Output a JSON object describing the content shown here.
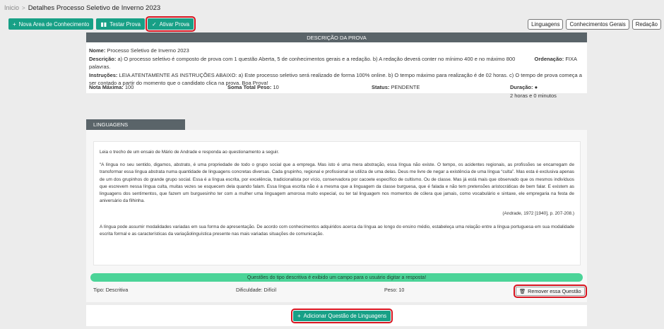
{
  "breadcrumb": {
    "home": "Inicio",
    "separator": ">",
    "current": "Detalhes Processo Seletivo de Inverno 2023"
  },
  "toolbar": {
    "new_area": "Nova Area de Conhecimento",
    "test": "Testar Prova",
    "activate": "Ativar Prova"
  },
  "tabs": [
    "Linguagens",
    "Conhecimentos Gerais",
    "Redação"
  ],
  "description": {
    "header": "DESCRIÇÃO DA PROVA",
    "name_label": "Nome:",
    "name_value": "Processo Seletivo de Inverno 2023",
    "desc_label": "Descrição:",
    "desc_value": "a) O processo seletivo é composto de prova com 1 questão Aberta, 5 de conhecimentos gerais e a redação. b) A redação deverá conter no mínimo 400 e no máximo 800 palavras.",
    "order_label": "Ordenação:",
    "order_value": "FIXA",
    "instr_label": "Instruções:",
    "instr_value": "LEIA ATENTAMENTE AS INSTRUÇÕES ABAIXO: a) Este processo seletivo será realizado de forma 100% online. b) O tempo máximo para realização é de 02 horas. c) O tempo de prova começa a ser contado a partir do momento que o candidato clica na prova. Boa Prova!",
    "max_label": "Nota Máxima:",
    "max_value": "100",
    "sum_label": "Soma Total Peso:",
    "sum_value": "10",
    "status_label": "Status:",
    "status_value": "PENDENTE",
    "duration_label": "Duração:",
    "duration_value": "2 horas e 0 minutos"
  },
  "section": {
    "title": "LINGUAGENS",
    "intro": "Leia o trecho de um ensaio de Mário de Andrade e responda ao questionamento a seguir.",
    "quote": "“A língua no seu sentido, digamos, abstrato, é uma propriedade de todo o grupo social que a emprega. Mas isto é uma mera abstração, essa língua não existe. O tempo, os acidentes regionais, as profissões se encarregam de transformar essa língua abstrata numa quantidade de linguagens concretas diversas. Cada grupinho, regional e profissional se utiliza de uma delas. Deus me livre de negar a existência de uma língua “culta”. Mas esta é exclusiva apenas de um dos grupinhos do grande grupo social. Essa é a língua escrita, por excelência, tradicionalista por vício, conservadora por cacoete específico de cultismo. Ou de classe. Mas já está mais que observado que os mesmos indivíduos que escrevem nessa língua culta, muitas vezes se esquecem dela quando falam. Essa língua escrita não é a mesma que a linguagem da classe burguesa, que é falada e não tem pretensões aristocráticas de bem falar. E existem as linguagens dos sentimentos, que fazem um burguesinho ter com a mulher uma linguagem amorosa muito especial, ou ter tal linguagem nos momentos de cólera que jamais, como vocabulário e sintaxe, ele empregaria na festa de aniversário da filhinha.",
    "citation": "(Andrade, 1972 [1940], p. 207-208.)",
    "question": "A língua pode assumir modalidades variadas em sua forma de apresentação. De acordo com conhecimentos adquiridos acerca da língua ao longo do ensino médio, estabeleça uma relação entre a língua portuguesa em sua modalidade escrita formal e as características da variaçãolinguística presente nas mais variadas situações de comunicação.",
    "note": "Questões do tipo descritiva é exibido um campo para o usuário digitar a resposta!",
    "type": "Tipo: Descritiva",
    "difficulty": "Dificuldade: Difícil",
    "weight": "Peso: 10",
    "remove": "Remover essa Questão",
    "add": "Adicionar Questão de Linguagens"
  },
  "colors": {
    "primary": "#17a086",
    "header": "#5a6469",
    "note": "#4bd498",
    "highlight": "#d7141f"
  }
}
